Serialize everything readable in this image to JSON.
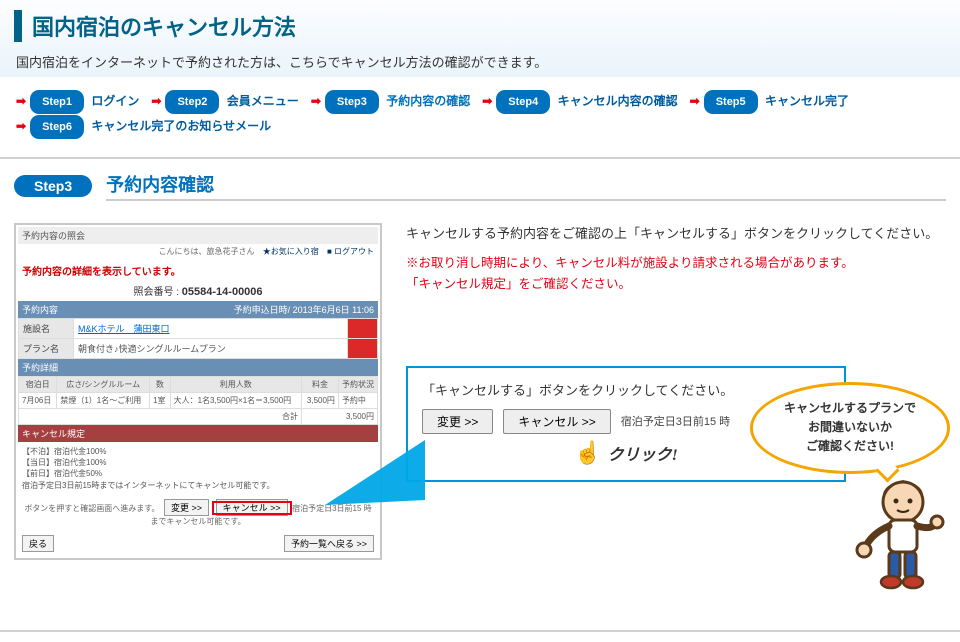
{
  "header": {
    "title": "国内宿泊のキャンセル方法",
    "subtitle": "国内宿泊をインターネットで予約された方は、こちらでキャンセル方法の確認ができます。"
  },
  "steps": [
    {
      "badge": "Step1",
      "label": "ログイン"
    },
    {
      "badge": "Step2",
      "label": "会員メニュー"
    },
    {
      "badge": "Step3",
      "label": "予約内容の確認"
    },
    {
      "badge": "Step4",
      "label": "キャンセル内容の確認"
    },
    {
      "badge": "Step5",
      "label": "キャンセル完了"
    },
    {
      "badge": "Step6",
      "label": "キャンセル完了のお知らせメール"
    }
  ],
  "stepHeader": {
    "pill": "Step3",
    "title": "予約内容確認"
  },
  "mock": {
    "head": "予約内容の照会",
    "greeting": "こんにちは、旅急花子さん",
    "fav": "★お気に入り宿",
    "logout": "■ ログアウト",
    "redmsg": "予約内容の詳細を表示しています。",
    "inquiryLabel": "照会番号 :",
    "inquiryNo": "05584-14-00006",
    "section1": "予約内容",
    "timestamp": "予約申込日時/ 2013年6月6日 11:06",
    "row1Lbl": "施設名",
    "row1Val": "M&Kホテル　蒲田東口",
    "row2Lbl": "プラン名",
    "row2Val": "朝食付き♪快適シングルルームプラン",
    "section2": "予約詳細",
    "th": [
      "宿泊日",
      "広さ/シングルルーム",
      "数",
      "利用人数",
      "料金",
      "予約状況"
    ],
    "td": [
      "7月06日",
      "禁煙（1）1名〜ご利用",
      "1室",
      "大人：1名3,500円×1名＝3,500円",
      "3,500円",
      "予約中"
    ],
    "totalLabel": "合計",
    "totalPrice": "3,500円",
    "section3": "キャンセル規定",
    "rules": [
      "【不泊】宿泊代金100%",
      "【当日】宿泊代金100%",
      "【前日】宿泊代金50%",
      "宿泊予定日3日前15時まではインターネットにてキャンセル可能です。"
    ],
    "hint": "ボタンを押すと確認画面へ進みます。",
    "btnChange": "変更 >>",
    "btnCancel": "キャンセル >>",
    "btnDeadline": "宿泊予定日3日前15 時までキャンセル可能です。",
    "btnBack": "戻る",
    "btnList": "予約一覧へ戻る >>"
  },
  "right": {
    "lead": "キャンセルする予約内容をご確認の上「キャンセルする」ボタンをクリックしてください。",
    "warn1": "※お取り消し時期により、キャンセル料が施設より請求される場合があります。",
    "warn2": "「キャンセル規定」をご確認ください。"
  },
  "callout": {
    "title": "「キャンセルする」ボタンをクリックしてください。",
    "btnChange": "変更 >>",
    "btnCancel": "キャンセル >>",
    "note": "宿泊予定日3日前15 時",
    "clickLabel": "クリック!"
  },
  "bubble": {
    "l1": "キャンセルするプランで",
    "l2": "お間違いないか",
    "l3": "ご確認ください!"
  }
}
